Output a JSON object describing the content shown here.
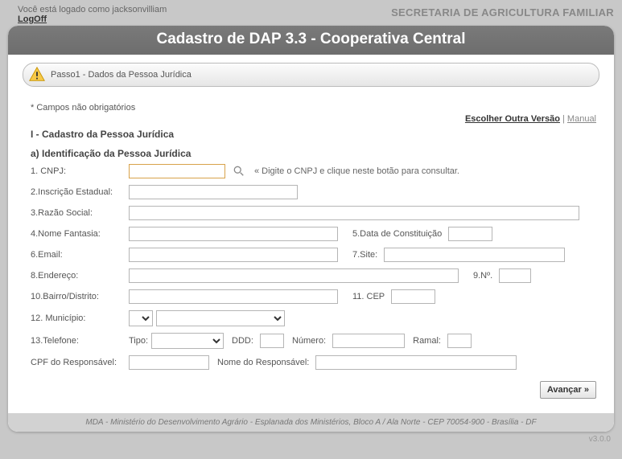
{
  "header": {
    "login_text": "Você está logado como jacksonvilliam",
    "logoff": "LogOff",
    "secretaria": "SECRETARIA DE AGRICULTURA FAMILIAR"
  },
  "title": "Cadastro de DAP 3.3 - Cooperativa Central",
  "step": "Passo1 - Dados da Pessoa Jurídica",
  "obrigatorios": "* Campos não obrigatórios",
  "links": {
    "escolher": "Escolher Outra Versão",
    "sep": " | ",
    "manual": "Manual"
  },
  "section": "I - Cadastro da Pessoa Jurídica",
  "subsection": "a) Identificação da Pessoa Jurídica",
  "labels": {
    "cnpj": "1. CNPJ:",
    "cnpj_hint": "« Digite o CNPJ e clique neste botão para consultar.",
    "inscricao": "2.Inscrição Estadual:",
    "razao": "3.Razão Social:",
    "fantasia": "4.Nome Fantasia:",
    "data_const": "5.Data de Constituição",
    "email": "6.Email:",
    "site": "7.Site:",
    "endereco": "8.Endereço:",
    "num": "9.Nº.",
    "bairro": "10.Bairro/Distrito:",
    "cep": "11. CEP",
    "municipio": "12. Município:",
    "telefone": "13.Telefone:",
    "tipo": "Tipo:",
    "ddd": "DDD:",
    "numero": "Número:",
    "ramal": "Ramal:",
    "cpf_resp": "CPF do Responsável:",
    "nome_resp": "Nome do Responsável:"
  },
  "advance": "Avançar »",
  "footer": "MDA - Ministério do Desenvolvimento Agrário - Esplanada dos Ministérios, Bloco A / Ala Norte - CEP 70054-900 - Brasília - DF",
  "version": "v3.0.0"
}
